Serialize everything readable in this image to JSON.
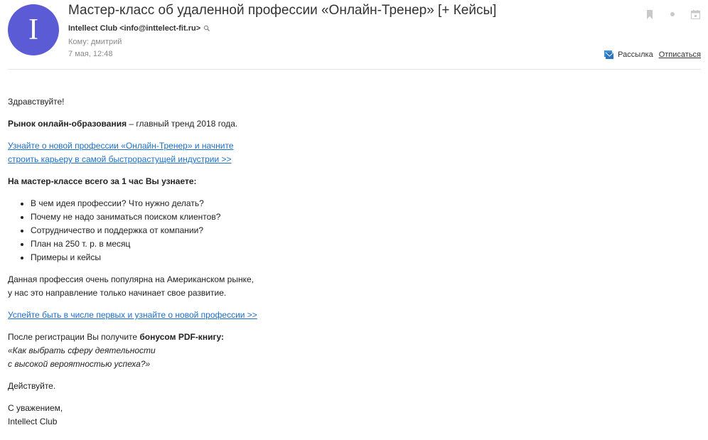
{
  "header": {
    "avatar_letter": "I",
    "subject": "Мастер-класс об удаленной профессии «Онлайн-Тренер» [+ Кейсы]",
    "sender": "Intellect Club <info@inttelect-fit.ru>",
    "to": "Кому: дмитрий",
    "date": "7 мая, 12:48",
    "mailing_label": "Рассылка",
    "unsubscribe_label": "Отписаться",
    "colors": {
      "avatar": "#5b5bd6",
      "link": "#1a6fc9"
    }
  },
  "body": {
    "greeting": "Здравствуйте!",
    "trend_bold": "Рынок онлайн-образования",
    "trend_rest": " – главный тренд 2018 года.",
    "link1_line1": "Узнайте о новой профессии «Онлайн-Тренер» и начните",
    "link1_line2": "строить карьеру в самой быстрорастущей индустрии >>",
    "learn_heading": "На мастер-классе всего за 1 час Вы узнаете:",
    "bullets": [
      "В чем идея профессии? Что нужно делать?",
      "Почему не надо заниматься поиском клиентов?",
      "Сотрудничество и поддержка от компании?",
      "План на 250 т. р. в месяц",
      "Примеры и кейсы"
    ],
    "popular_line1": "Данная профессия очень популярна на Американском рынке,",
    "popular_line2": "у нас это направление только начинает свое развитие.",
    "link2": "Успейте быть в числе первых и узнайте о новой профессии >>",
    "bonus_prefix": "После регистрации Вы получите ",
    "bonus_bold": "бонусом PDF-книгу:",
    "book_line1": "«Как выбрать сферу деятельности",
    "book_line2": "с высокой вероятностью успеха?»",
    "call": "Действуйте.",
    "regards": "С уважением,",
    "signature": "Intellect Club"
  }
}
